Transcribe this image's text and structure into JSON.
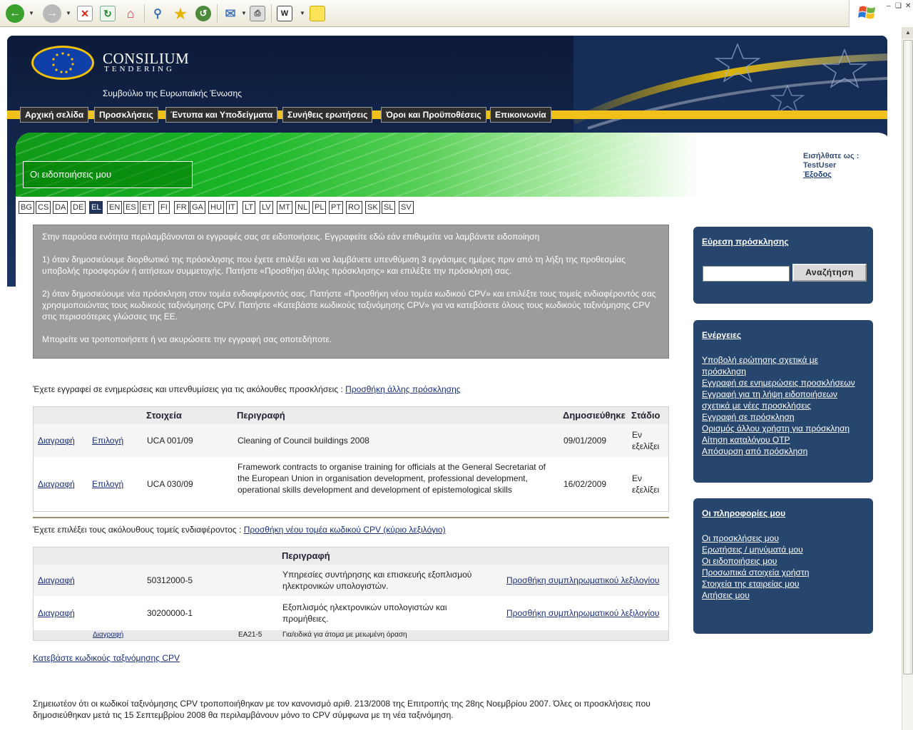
{
  "browser": {
    "toolbar_icons": [
      "back-icon",
      "forward-icon",
      "stop-icon",
      "refresh-icon",
      "home-icon",
      "search-icon",
      "favorites-icon",
      "history-icon",
      "mail-icon",
      "print-icon",
      "edit-icon",
      "note-icon"
    ]
  },
  "header": {
    "logo_name": "CONSILIUM",
    "logo_sub": "TENDERING",
    "org_name": "Συμβούλιο της Ευρωπαϊκής Ένωσης"
  },
  "nav": [
    "Αρχική σελίδα",
    "Προσκλήσεις",
    "Έντυπα και Υποδείγματα",
    "Συνήθεις ερωτήσεις",
    "Όροι και Προϋποθέσεις",
    "Επικοινωνία"
  ],
  "banner": {
    "title": "Οι ειδοποιήσεις μου"
  },
  "login": {
    "label": "Εισήλθατε ως :",
    "user": "TestUser",
    "logout": "Έξοδος"
  },
  "languages": {
    "items": [
      "BG",
      "CS",
      "DA",
      "DE",
      "EL",
      "EN",
      "ES",
      "ET",
      "FI",
      "FR",
      "GA",
      "HU",
      "IT",
      "LT",
      "LV",
      "MT",
      "NL",
      "PL",
      "PT",
      "RO",
      "SK",
      "SL",
      "SV"
    ],
    "active": "EL"
  },
  "info": {
    "p1": "Στην παρούσα ενότητα περιλαμβάνονται οι εγγραφές σας σε ειδοποιήσεις. Εγγραφείτε εδώ εάν επιθυμείτε να λαμβάνετε ειδοποίηση",
    "p2": "1) όταν δημοσιεύουμε διορθωτικό της πρόσκλησης που έχετε επιλέξει και να λαμβάνετε υπενθύμιση 3 εργάσιμες ημέρες πριν από τη λήξη της προθεσμίας υποβολής προσφορών ή αιτήσεων συμμετοχής. Πατήστε «Προσθήκη άλλης πρόσκλησης» και επιλέξτε την πρόσκλησή σας.",
    "p3": "2) όταν δημοσιεύουμε νέα πρόσκληση στον τομέα ενδιαφέροντός σας. Πατήστε «Προσθήκη νέου τομέα κωδικού CPV» και επιλέξτε τους τομείς ενδιαφέροντός σας χρησιμοποιώντας τους κωδικούς ταξινόμησης CPV. Πατήστε «Κατεβάστε κωδικούς ταξινόμησης CPV» για να κατεβάσετε όλους τους κωδικούς ταξινόμησης CPV στις περισσότερες γλώσσες της ΕΕ.",
    "p4": "Μπορείτε να τροποποιήσετε ή να ακυρώσετε την εγγραφή σας οποτεδήποτε."
  },
  "calls_section": {
    "intro": "Έχετε εγγραφεί σε ενημερώσεις και υπενθυμίσεις για τις ακόλουθες προσκλήσεις :",
    "add_link": "Προσθήκη άλλης πρόσκλησης",
    "headers": {
      "ref": "Στοιχεία",
      "desc": "Περιγραφή",
      "published": "Δημοσιεύθηκε",
      "stage": "Στάδιο"
    },
    "rows": [
      {
        "delete": "Διαγραφή",
        "select": "Επιλογή",
        "ref": "UCA 001/09",
        "desc": "Cleaning of Council buildings 2008",
        "published": "09/01/2009",
        "stage": "Εν εξελίξει"
      },
      {
        "delete": "Διαγραφή",
        "select": "Επιλογή",
        "ref": "UCA 030/09",
        "desc": "Framework contracts to organise training for officials at the General Secretariat of the European Union in organisation development, professional development, operational skills development and development of epistemological skills",
        "published": "16/02/2009",
        "stage": "Εν εξελίξει"
      }
    ]
  },
  "cpv_section": {
    "intro": "Έχετε επιλέξει τους ακόλουθους τομείς ενδιαφέροντος :",
    "add_link": "Προσθήκη νέου τομέα κωδικού CPV (κύριο λεξιλόγιο)",
    "headers": {
      "desc": "Περιγραφή"
    },
    "rows": [
      {
        "delete": "Διαγραφή",
        "code": "50312000-5",
        "desc": "Υπηρεσίες συντήρησης και επισκευής εξοπλισμού ηλεκτρονικών υπολογιστών.",
        "add": "Προσθήκη συμπληρωματικού λεξιλογίου"
      },
      {
        "delete": "Διαγραφή",
        "code": "30200000-1",
        "desc": "Εξοπλισμός ηλεκτρονικών υπολογιστών και προμήθειες.",
        "add": "Προσθήκη συμπληρωματικού λεξιλογίου"
      }
    ],
    "sub_row": {
      "delete": "Διαγραφή",
      "code": "EA21-5",
      "desc": "Για/ειδικά για άτομα με μειωμένη όραση"
    }
  },
  "download_link": "Κατεβάστε κωδικούς ταξινόμησης CPV",
  "footer_note": "Σημειωτέον ότι οι κωδικοί ταξινόμησης CPV τροποποιήθηκαν με τον κανονισμό αριθ. 213/2008 της Επιτροπής της 28ης Νοεμβρίου 2007. Όλες οι προσκλήσεις που δημοσιεύθηκαν μετά τις 15 Σεπτεμβρίου 2008 θα περιλαμβάνουν μόνο το CPV σύμφωνα με τη νέα ταξινόμηση.",
  "sidebar": {
    "search": {
      "title": "Εύρεση πρόσκλησης",
      "button": "Αναζήτηση",
      "value": ""
    },
    "actions": {
      "title": "Ενέργειες",
      "items": [
        "Υποβολή ερώτησης σχετικά με πρόσκληση",
        "Εγγραφή σε ενημερώσεις προσκλήσεων",
        "Εγγραφή για τη λήψη ειδοποιήσεων σχετικά με νέες προσκλήσεις",
        "Εγγραφή σε πρόσκληση",
        "Ορισμός άλλου χρήστη για πρόσκληση",
        "Αίτηση καταλόγου OTP",
        "Απόσυρση από πρόσκληση"
      ]
    },
    "info": {
      "title": "Οι πληροφορίες μου",
      "items": [
        "Οι προσκλήσεις μου",
        "Ερωτήσεις / μηνύματά μου",
        "Οι ειδοποιήσεις μου",
        "Προσωπικά στοιχεία χρήστη",
        "Στοιχεία της εταιρείας μου",
        "Αιτήσεις μου"
      ]
    }
  }
}
